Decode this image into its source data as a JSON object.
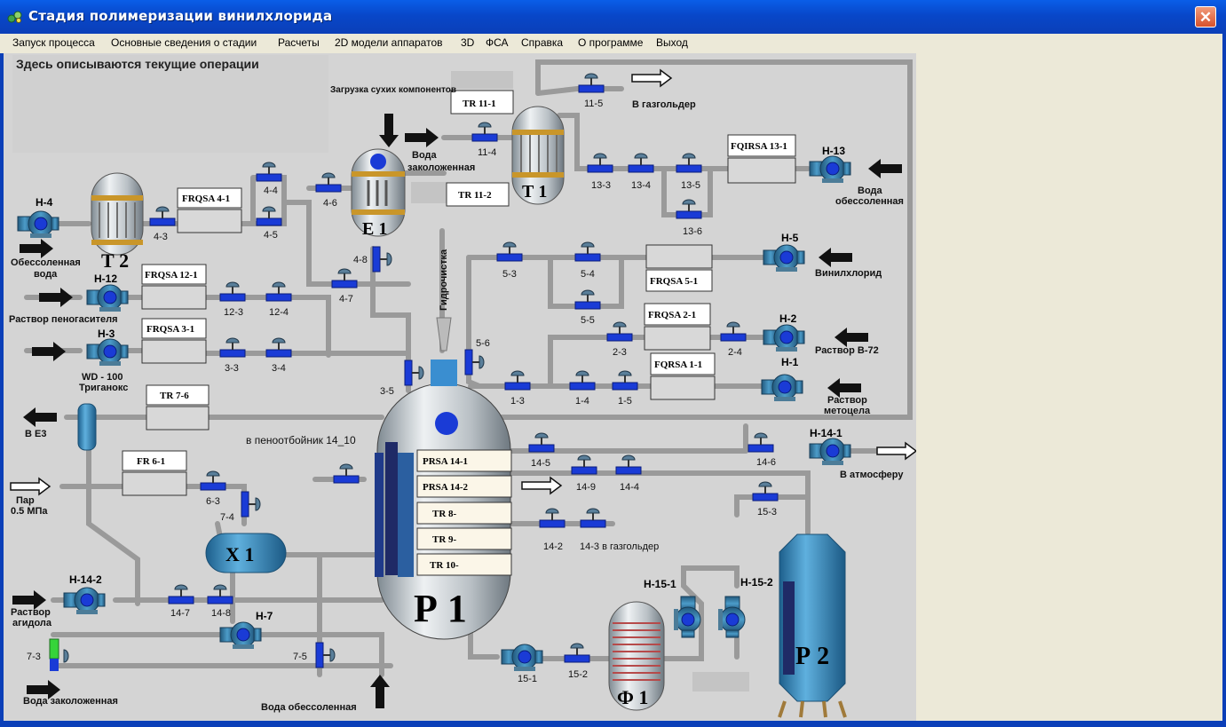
{
  "window": {
    "title": "Стадия полимеризации винилхлорида",
    "close_label": "✕"
  },
  "menu": [
    "Запуск процесса",
    "Основные сведения о стадии",
    "Расчеты",
    "2D модели аппаратов",
    "3D",
    "ФСА",
    "Справка",
    "О программе",
    "Выход"
  ],
  "operations_panel": {
    "text": "Здесь описываются текущие операции"
  },
  "colors": {
    "panel_bg": "#d4d4d4",
    "pipe": "#9a9a9a",
    "valve": "#1a3bd6",
    "vessel": "#2f7fb3",
    "title_blue": "#0a5ee8"
  },
  "apparatus": {
    "T2": "Т 2",
    "T1": "Т 1",
    "E1": "Е 1",
    "R1": "Р 1",
    "R2": "Р 2",
    "X1": "Х 1",
    "F1": "Ф 1"
  },
  "instruments": {
    "FRQSA41": "FRQSA 4-1",
    "FRQSA121": "FRQSA 12-1",
    "FRQSA31": "FRQSA 3-1",
    "TR76": "TR 7-6",
    "FR61": "FR 6-1",
    "TR111": "TR 11-1",
    "TR112": "TR 11-2",
    "FQIRSA131": "FQIRSA 13-1",
    "FRQSA51": "FRQSA 5-1",
    "FRQSA21": "FRQSA 2-1",
    "FQRSA11": "FQRSA 1-1",
    "PRSA141": "PRSA 14-1",
    "PRSA142": "PRSA 14-2",
    "TR8": "TR 8-",
    "TR9": "TR 9-",
    "TR10": "TR 10-"
  },
  "pumps": {
    "H4": "Н-4",
    "H12": "Н-12",
    "H3": "Н-3",
    "H13": "Н-13",
    "H5": "Н-5",
    "H2": "Н-2",
    "H1": "Н-1",
    "H141": "Н-14-1",
    "H142": "Н-14-2",
    "H7": "Н-7",
    "H151": "Н-15-1",
    "H152": "Н-15-2"
  },
  "valves": {
    "v43": "4-3",
    "v44": "4-4",
    "v45": "4-5",
    "v46": "4-6",
    "v47": "4-7",
    "v48": "4-8",
    "v123": "12-3",
    "v124": "12-4",
    "v33": "3-3",
    "v34": "3-4",
    "v35": "3-5",
    "v115": "11-5",
    "v114": "11-4",
    "v133": "13-3",
    "v134": "13-4",
    "v135": "13-5",
    "v136": "13-6",
    "v53": "5-3",
    "v54": "5-4",
    "v55": "5-5",
    "v56": "5-6",
    "v23": "2-3",
    "v24": "2-4",
    "v13": "1-3",
    "v14": "1-4",
    "v15": "1-5",
    "v145": "14-5",
    "v149": "14-9",
    "v144": "14-4",
    "v146": "14-6",
    "v142": "14-2",
    "v143": "14-3 в газгольдер",
    "v153": "15-3",
    "v63": "6-3",
    "v74": "7-4",
    "v147": "14-7",
    "v148": "14-8",
    "v73": "7-3",
    "v75": "7-5",
    "v151": "15-1",
    "v152": "15-2"
  },
  "labels": {
    "loading": "Загрузка сухих компонентов",
    "water_in": "Вода",
    "water_in2": "заколоженная",
    "to_gasholder": "В газгольдер",
    "demin_water_t2": "Обессоленная",
    "demin_water_t2b": "вода",
    "water_demin_13": "Вода",
    "water_demin_13b": "обессоленная",
    "vinylchloride": "Винилхлорид",
    "b72": "Раствор В-72",
    "methocel": "Раствор",
    "methocel2": "метоцела",
    "antifoam": "Раствор пеногасителя",
    "trigonox1": "WD - 100",
    "trigonox2": "Триганокс",
    "to_e3": "В Е3",
    "foam_trap": "в пеноотбойник 14_10",
    "steam1": "Пар",
    "steam2": "0.5 МПа",
    "hydro": "Гидрочистка",
    "atm": "В атмосферу",
    "agidol1": "Раствор",
    "agidol2": "агидола",
    "water_low": "Вода заколоженная",
    "water_demin_low": "Вода обессоленная"
  }
}
